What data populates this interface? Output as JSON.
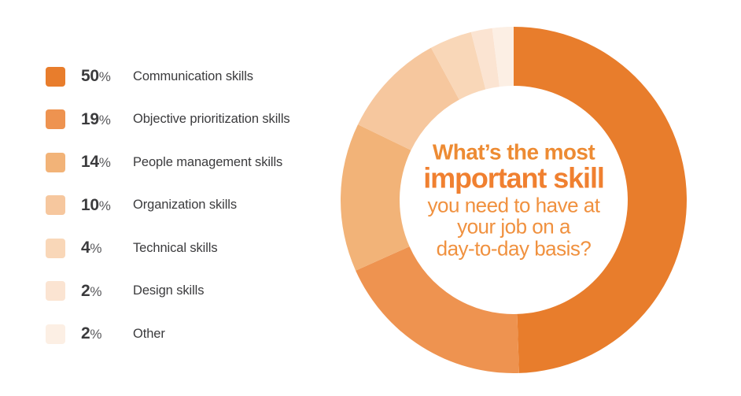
{
  "chart_data": {
    "type": "pie",
    "variant": "donut",
    "title": "What's the most important skill you need to have at your job on a day-to-day basis?",
    "categories": [
      "Communication skills",
      "Objective prioritization skills",
      "People management skills",
      "Organization skills",
      "Technical skills",
      "Design skills",
      "Other"
    ],
    "values": [
      50,
      19,
      14,
      10,
      4,
      2,
      2
    ],
    "value_labels": [
      "50",
      "19",
      "14",
      "10",
      "4",
      "2",
      "2"
    ],
    "unit": "%",
    "colors": [
      "#E87D2C",
      "#EE9350",
      "#F2B378",
      "#F6C79E",
      "#F9D7B8",
      "#FBE4D2",
      "#FCEFE4"
    ],
    "start_angle_deg": 0,
    "direction": "clockwise",
    "legend_position": "left",
    "grid": false,
    "xlabel": "",
    "ylabel": ""
  },
  "legend": {
    "items": [
      {
        "percent": "50",
        "sign": "%",
        "label": "Communication skills",
        "color": "#E87D2C"
      },
      {
        "percent": "19",
        "sign": "%",
        "label": "Objective prioritization skills",
        "color": "#EE9350"
      },
      {
        "percent": "14",
        "sign": "%",
        "label": "People management skills",
        "color": "#F2B378"
      },
      {
        "percent": "10",
        "sign": "%",
        "label": "Organization skills",
        "color": "#F6C79E"
      },
      {
        "percent": "4",
        "sign": "%",
        "label": "Technical skills",
        "color": "#F9D7B8"
      },
      {
        "percent": "2",
        "sign": "%",
        "label": "Design skills",
        "color": "#FBE4D2"
      },
      {
        "percent": "2",
        "sign": "%",
        "label": "Other",
        "color": "#FCEFE4"
      }
    ]
  },
  "center_text": {
    "line1": "What’s the most",
    "line2": "important skill",
    "line3": "you need to have at",
    "line4": "your job on a",
    "line5": "day-to-day basis?"
  }
}
